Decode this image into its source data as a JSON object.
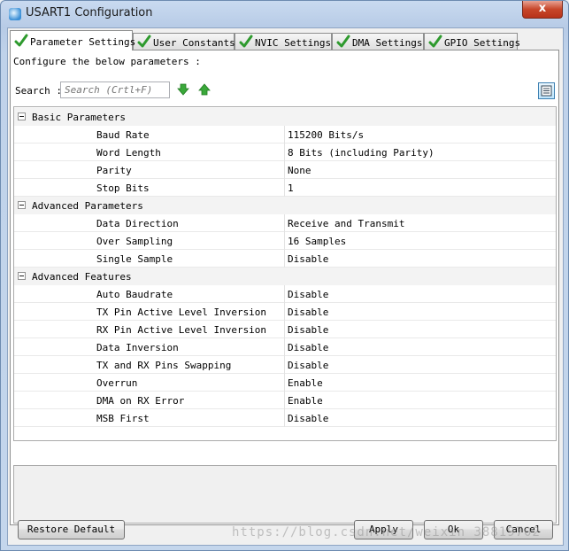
{
  "window": {
    "title": "USART1 Configuration",
    "close_label": "x"
  },
  "tabs": [
    {
      "label": "Parameter Settings",
      "active": true
    },
    {
      "label": "User Constants",
      "active": false
    },
    {
      "label": "NVIC Settings",
      "active": false
    },
    {
      "label": "DMA Settings",
      "active": false
    },
    {
      "label": "GPIO Settings",
      "active": false
    }
  ],
  "panel": {
    "instruction": "Configure the below parameters :",
    "search_label": "Search :",
    "search_placeholder": "Search (Crtl+F)"
  },
  "tree": {
    "groups": [
      {
        "label": "Basic Parameters",
        "params": [
          {
            "name": "Baud Rate",
            "value": "115200 Bits/s"
          },
          {
            "name": "Word Length",
            "value": "8 Bits (including Parity)"
          },
          {
            "name": "Parity",
            "value": "None"
          },
          {
            "name": "Stop Bits",
            "value": "1"
          }
        ]
      },
      {
        "label": "Advanced Parameters",
        "params": [
          {
            "name": "Data Direction",
            "value": "Receive and Transmit"
          },
          {
            "name": "Over Sampling",
            "value": "16 Samples"
          },
          {
            "name": "Single Sample",
            "value": "Disable"
          }
        ]
      },
      {
        "label": "Advanced Features",
        "params": [
          {
            "name": "Auto Baudrate",
            "value": "Disable"
          },
          {
            "name": "TX Pin Active Level Inversion",
            "value": "Disable"
          },
          {
            "name": "RX Pin Active Level Inversion",
            "value": "Disable"
          },
          {
            "name": "Data Inversion",
            "value": "Disable"
          },
          {
            "name": "TX and RX Pins Swapping",
            "value": "Disable"
          },
          {
            "name": "Overrun",
            "value": "Enable"
          },
          {
            "name": "DMA on RX Error",
            "value": "Enable"
          },
          {
            "name": "MSB First",
            "value": "Disable"
          }
        ]
      }
    ]
  },
  "buttons": {
    "restore": "Restore Default",
    "apply": "Apply",
    "ok": "Ok",
    "cancel": "Cancel"
  },
  "watermark": "https://blog.csdn.net/weixin_38819702",
  "colors": {
    "check_green": "#2e9a2e",
    "arrow_green": "#3aa83a",
    "close_red": "#c7462a"
  },
  "icons": {
    "tab_status": "check-icon",
    "find_next": "arrow-down-icon",
    "find_prev": "arrow-up-icon",
    "view_toggle": "list-view-icon"
  }
}
